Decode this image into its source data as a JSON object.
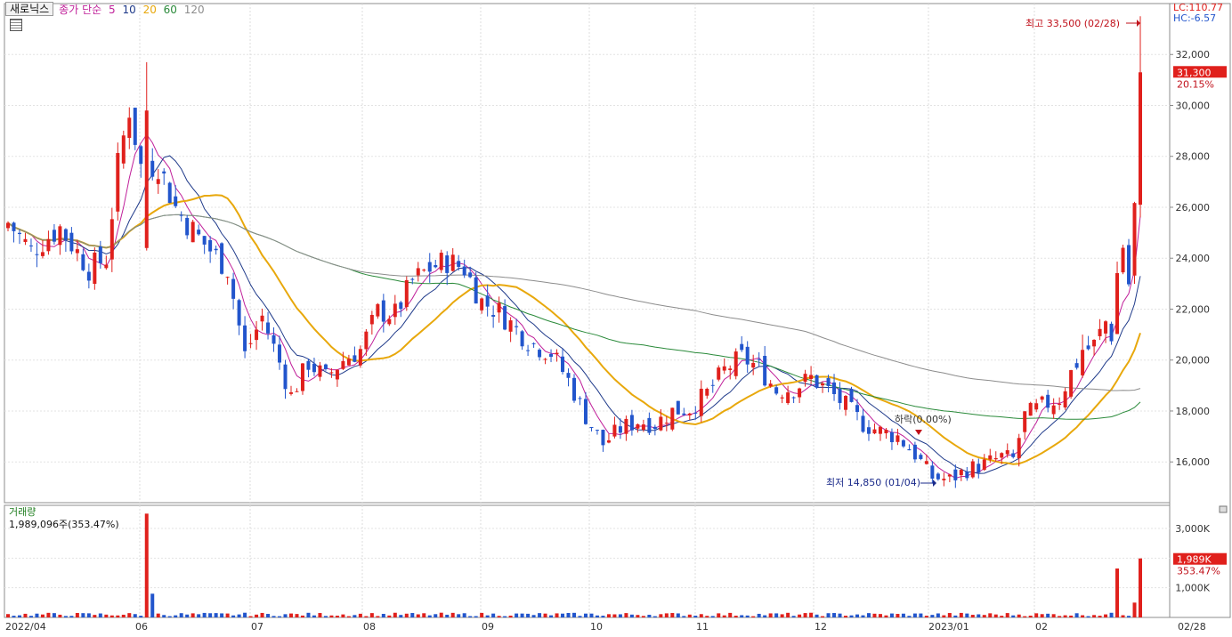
{
  "header": {
    "stock_name": "새로닉스",
    "ma_prefix": "종가 단순",
    "ma_periods": [
      "5",
      "10",
      "20",
      "60",
      "120"
    ],
    "ma_colors": [
      "#c0209a",
      "#1f3a8a",
      "#e8a80c",
      "#2a8a3a",
      "#8c8c8c"
    ],
    "lc_label": "LC:110.77",
    "hc_label": "HC:-6.57"
  },
  "price_panel": {
    "current_price": "31,300",
    "change_pct": "20.15%",
    "high_annotation": "최고 33,500 (02/28)",
    "low_annotation": "최저 14,850 (01/04)",
    "limit_down_annotation": "하락(0.00%)",
    "up_color": "#e0201c",
    "down_color": "#2255cc"
  },
  "volume_panel": {
    "title": "거래량",
    "summary": "1,989,096주(353.47%)",
    "current_volume": "1,989K",
    "change_pct": "353.47%"
  },
  "chart_data": [
    {
      "type": "candlestick",
      "title": "새로닉스",
      "y_ticks": [
        "16,000",
        "18,000",
        "20,000",
        "22,000",
        "24,000",
        "26,000",
        "28,000",
        "30,000",
        "32,000"
      ],
      "ylim": [
        14400,
        34000
      ],
      "x_tick_labels": [
        "2022/04",
        "06",
        "07",
        "08",
        "09",
        "10",
        "11",
        "12",
        "2023/01",
        "02",
        "02/28"
      ],
      "grid": true,
      "legend": "top-left",
      "series": [
        {
          "name": "5",
          "type": "moving_average"
        },
        {
          "name": "10",
          "type": "moving_average"
        },
        {
          "name": "20",
          "type": "moving_average"
        },
        {
          "name": "60",
          "type": "moving_average"
        },
        {
          "name": "120",
          "type": "moving_average"
        }
      ],
      "close_anchors": [
        [
          0,
          25400
        ],
        [
          4,
          24300
        ],
        [
          9,
          25200
        ],
        [
          14,
          23600
        ],
        [
          17,
          24000
        ],
        [
          19,
          27600
        ],
        [
          21,
          29900
        ],
        [
          23,
          27600
        ],
        [
          26,
          27700
        ],
        [
          29,
          26000
        ],
        [
          33,
          24800
        ],
        [
          38,
          23600
        ],
        [
          41,
          20200
        ],
        [
          44,
          21700
        ],
        [
          47,
          19900
        ],
        [
          49,
          18600
        ],
        [
          52,
          19900
        ],
        [
          55,
          19300
        ],
        [
          58,
          20000
        ],
        [
          61,
          20400
        ],
        [
          64,
          21900
        ],
        [
          67,
          21800
        ],
        [
          70,
          23100
        ],
        [
          73,
          23600
        ],
        [
          76,
          23900
        ],
        [
          79,
          23600
        ],
        [
          82,
          22300
        ],
        [
          85,
          21900
        ],
        [
          88,
          21200
        ],
        [
          91,
          20600
        ],
        [
          94,
          20300
        ],
        [
          97,
          19200
        ],
        [
          100,
          17800
        ],
        [
          103,
          16700
        ],
        [
          106,
          17300
        ],
        [
          109,
          17600
        ],
        [
          112,
          17500
        ],
        [
          115,
          18000
        ],
        [
          118,
          18100
        ],
        [
          121,
          18700
        ],
        [
          124,
          19600
        ],
        [
          127,
          20100
        ],
        [
          130,
          19700
        ],
        [
          133,
          18800
        ],
        [
          136,
          18900
        ],
        [
          139,
          19300
        ],
        [
          142,
          18800
        ],
        [
          145,
          18200
        ],
        [
          148,
          17500
        ],
        [
          151,
          17200
        ],
        [
          154,
          17000
        ],
        [
          157,
          16300
        ],
        [
          160,
          15400
        ],
        [
          163,
          15300
        ],
        [
          166,
          15700
        ],
        [
          169,
          15900
        ],
        [
          172,
          16200
        ],
        [
          174,
          16100
        ],
        [
          176,
          17800
        ],
        [
          179,
          18200
        ],
        [
          182,
          18500
        ],
        [
          184,
          19500
        ],
        [
          186,
          20300
        ],
        [
          188,
          20600
        ],
        [
          190,
          21500
        ],
        [
          191,
          21000
        ],
        [
          192,
          23400
        ],
        [
          193,
          24500
        ],
        [
          194,
          23000
        ],
        [
          195,
          26000
        ],
        [
          196,
          31300
        ]
      ],
      "volume_y_ticks": [
        "1,000K",
        "2,000K",
        "3,000K"
      ],
      "volume_ylim": [
        0,
        3600
      ],
      "volume_spikes_k": [
        [
          24,
          3500
        ],
        [
          25,
          800
        ],
        [
          192,
          1650
        ],
        [
          195,
          500
        ],
        [
          196,
          1989
        ]
      ]
    }
  ]
}
